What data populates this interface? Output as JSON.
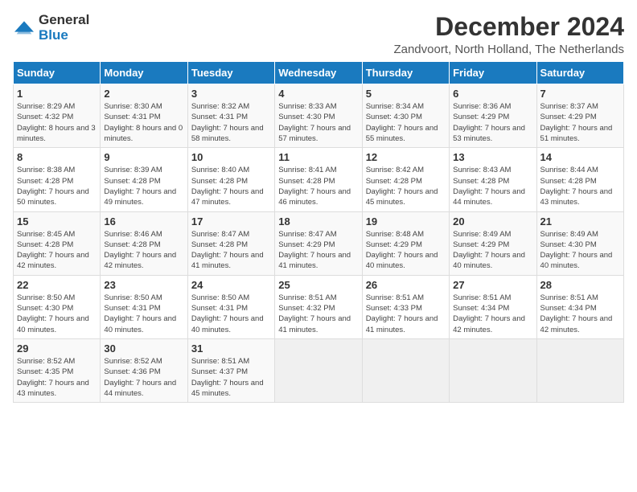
{
  "header": {
    "logo_general": "General",
    "logo_blue": "Blue",
    "month_title": "December 2024",
    "location": "Zandvoort, North Holland, The Netherlands"
  },
  "days_of_week": [
    "Sunday",
    "Monday",
    "Tuesday",
    "Wednesday",
    "Thursday",
    "Friday",
    "Saturday"
  ],
  "weeks": [
    [
      {
        "day": "1",
        "sunrise": "8:29 AM",
        "sunset": "4:32 PM",
        "daylight": "8 hours and 3 minutes."
      },
      {
        "day": "2",
        "sunrise": "8:30 AM",
        "sunset": "4:31 PM",
        "daylight": "8 hours and 0 minutes."
      },
      {
        "day": "3",
        "sunrise": "8:32 AM",
        "sunset": "4:31 PM",
        "daylight": "7 hours and 58 minutes."
      },
      {
        "day": "4",
        "sunrise": "8:33 AM",
        "sunset": "4:30 PM",
        "daylight": "7 hours and 57 minutes."
      },
      {
        "day": "5",
        "sunrise": "8:34 AM",
        "sunset": "4:30 PM",
        "daylight": "7 hours and 55 minutes."
      },
      {
        "day": "6",
        "sunrise": "8:36 AM",
        "sunset": "4:29 PM",
        "daylight": "7 hours and 53 minutes."
      },
      {
        "day": "7",
        "sunrise": "8:37 AM",
        "sunset": "4:29 PM",
        "daylight": "7 hours and 51 minutes."
      }
    ],
    [
      {
        "day": "8",
        "sunrise": "8:38 AM",
        "sunset": "4:28 PM",
        "daylight": "7 hours and 50 minutes."
      },
      {
        "day": "9",
        "sunrise": "8:39 AM",
        "sunset": "4:28 PM",
        "daylight": "7 hours and 49 minutes."
      },
      {
        "day": "10",
        "sunrise": "8:40 AM",
        "sunset": "4:28 PM",
        "daylight": "7 hours and 47 minutes."
      },
      {
        "day": "11",
        "sunrise": "8:41 AM",
        "sunset": "4:28 PM",
        "daylight": "7 hours and 46 minutes."
      },
      {
        "day": "12",
        "sunrise": "8:42 AM",
        "sunset": "4:28 PM",
        "daylight": "7 hours and 45 minutes."
      },
      {
        "day": "13",
        "sunrise": "8:43 AM",
        "sunset": "4:28 PM",
        "daylight": "7 hours and 44 minutes."
      },
      {
        "day": "14",
        "sunrise": "8:44 AM",
        "sunset": "4:28 PM",
        "daylight": "7 hours and 43 minutes."
      }
    ],
    [
      {
        "day": "15",
        "sunrise": "8:45 AM",
        "sunset": "4:28 PM",
        "daylight": "7 hours and 42 minutes."
      },
      {
        "day": "16",
        "sunrise": "8:46 AM",
        "sunset": "4:28 PM",
        "daylight": "7 hours and 42 minutes."
      },
      {
        "day": "17",
        "sunrise": "8:47 AM",
        "sunset": "4:28 PM",
        "daylight": "7 hours and 41 minutes."
      },
      {
        "day": "18",
        "sunrise": "8:47 AM",
        "sunset": "4:29 PM",
        "daylight": "7 hours and 41 minutes."
      },
      {
        "day": "19",
        "sunrise": "8:48 AM",
        "sunset": "4:29 PM",
        "daylight": "7 hours and 40 minutes."
      },
      {
        "day": "20",
        "sunrise": "8:49 AM",
        "sunset": "4:29 PM",
        "daylight": "7 hours and 40 minutes."
      },
      {
        "day": "21",
        "sunrise": "8:49 AM",
        "sunset": "4:30 PM",
        "daylight": "7 hours and 40 minutes."
      }
    ],
    [
      {
        "day": "22",
        "sunrise": "8:50 AM",
        "sunset": "4:30 PM",
        "daylight": "7 hours and 40 minutes."
      },
      {
        "day": "23",
        "sunrise": "8:50 AM",
        "sunset": "4:31 PM",
        "daylight": "7 hours and 40 minutes."
      },
      {
        "day": "24",
        "sunrise": "8:50 AM",
        "sunset": "4:31 PM",
        "daylight": "7 hours and 40 minutes."
      },
      {
        "day": "25",
        "sunrise": "8:51 AM",
        "sunset": "4:32 PM",
        "daylight": "7 hours and 41 minutes."
      },
      {
        "day": "26",
        "sunrise": "8:51 AM",
        "sunset": "4:33 PM",
        "daylight": "7 hours and 41 minutes."
      },
      {
        "day": "27",
        "sunrise": "8:51 AM",
        "sunset": "4:34 PM",
        "daylight": "7 hours and 42 minutes."
      },
      {
        "day": "28",
        "sunrise": "8:51 AM",
        "sunset": "4:34 PM",
        "daylight": "7 hours and 42 minutes."
      }
    ],
    [
      {
        "day": "29",
        "sunrise": "8:52 AM",
        "sunset": "4:35 PM",
        "daylight": "7 hours and 43 minutes."
      },
      {
        "day": "30",
        "sunrise": "8:52 AM",
        "sunset": "4:36 PM",
        "daylight": "7 hours and 44 minutes."
      },
      {
        "day": "31",
        "sunrise": "8:51 AM",
        "sunset": "4:37 PM",
        "daylight": "7 hours and 45 minutes."
      },
      null,
      null,
      null,
      null
    ]
  ],
  "labels": {
    "sunrise": "Sunrise:",
    "sunset": "Sunset:",
    "daylight": "Daylight:"
  }
}
